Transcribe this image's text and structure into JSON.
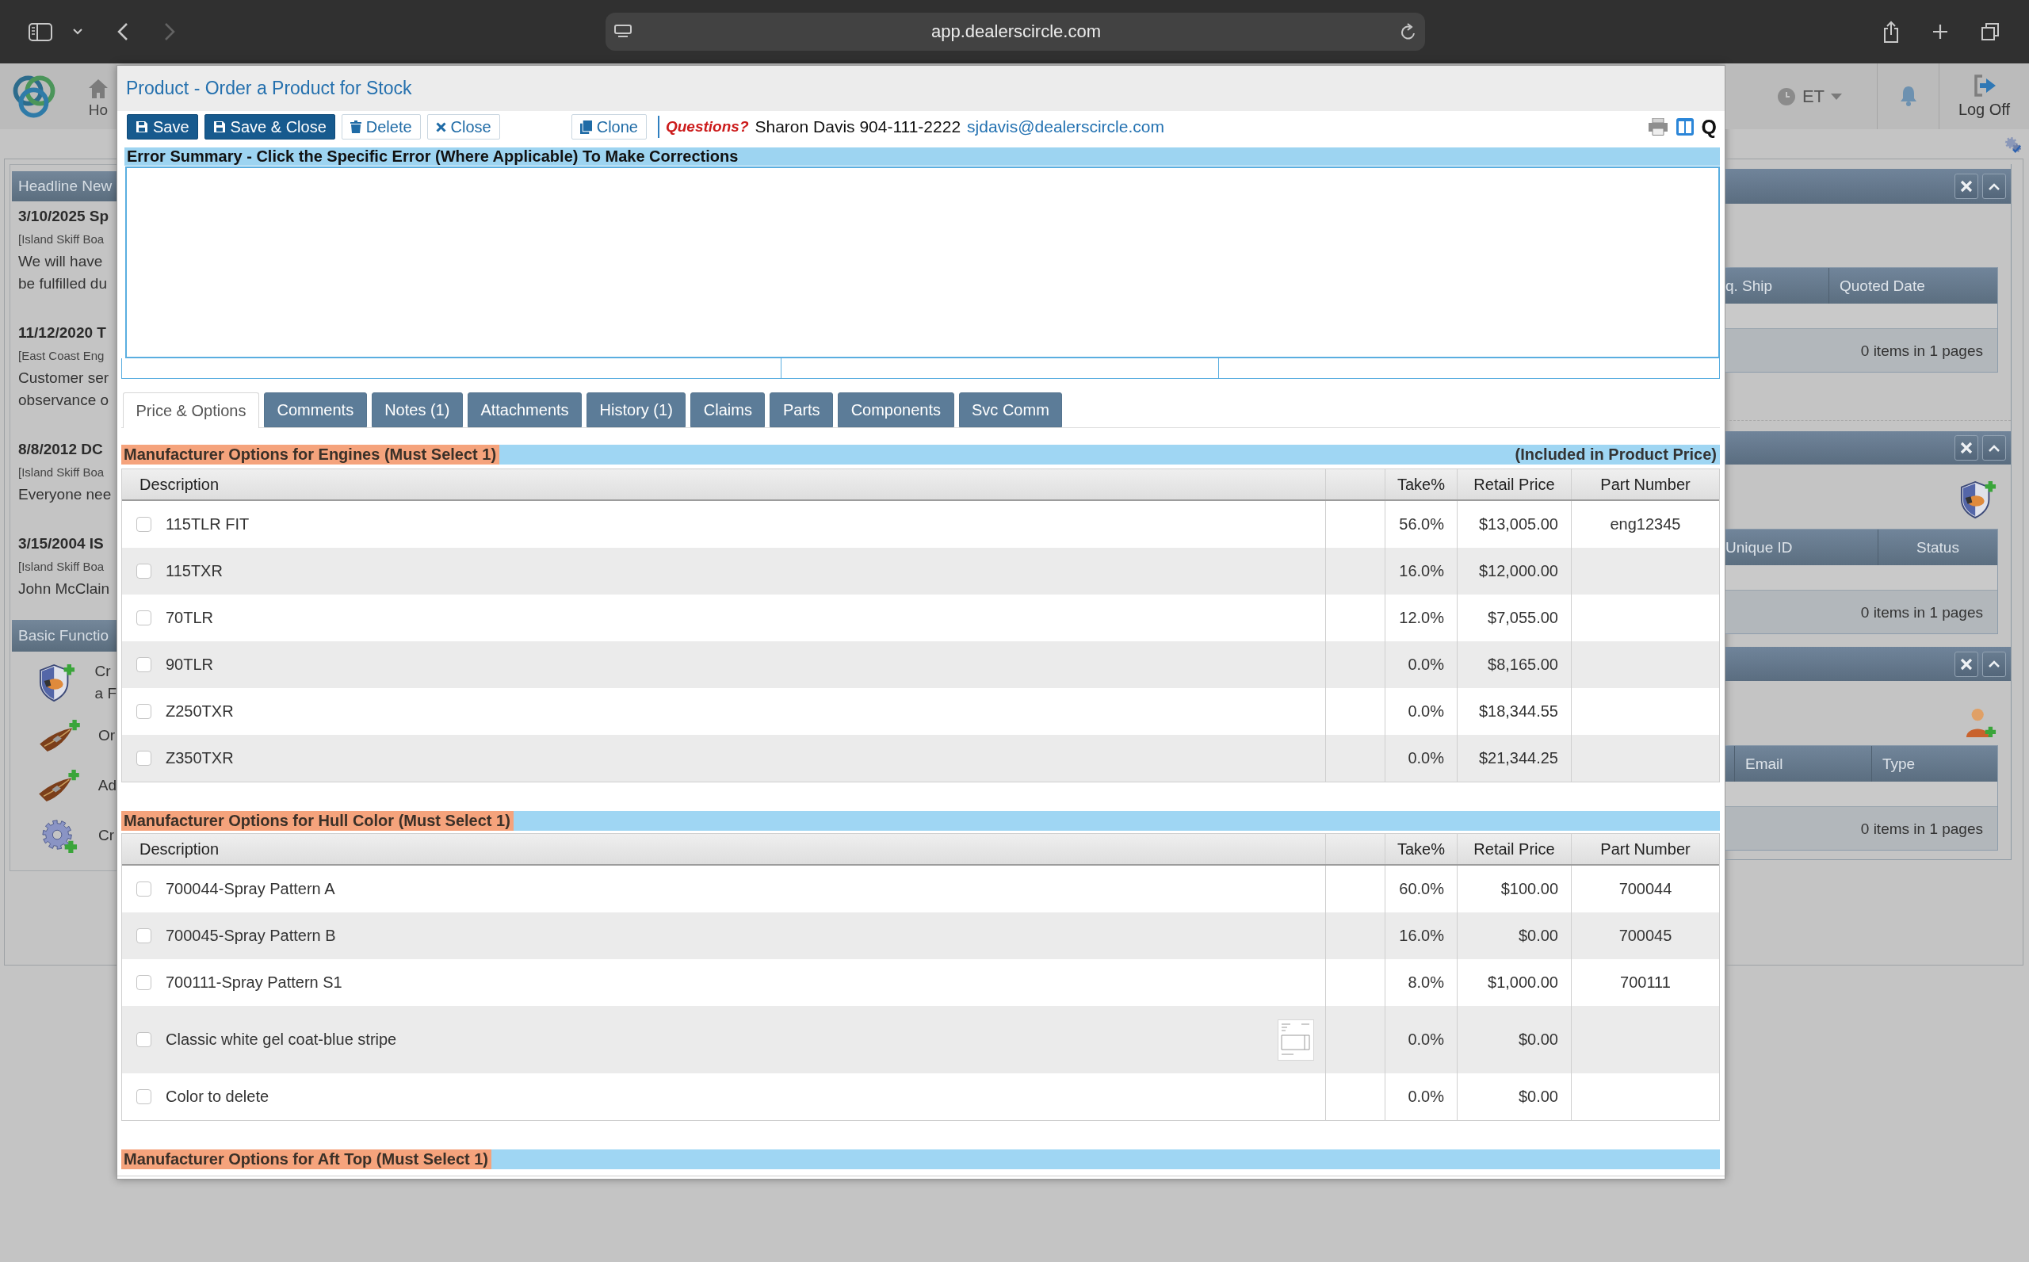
{
  "browser": {
    "url": "app.dealerscircle.com"
  },
  "app_header": {
    "home_label": "Ho",
    "timezone": "ET",
    "log_off": "Log Off"
  },
  "headline_news": {
    "title": "Headline New",
    "items": [
      {
        "title": "3/10/2025 Sp",
        "source": "[Island Skiff Boa",
        "lines": [
          "We will have",
          "be fulfilled du"
        ]
      },
      {
        "title": "11/12/2020 T",
        "source": "[East Coast Eng",
        "lines": [
          "Customer ser",
          "observance o"
        ]
      },
      {
        "title": "8/8/2012 DC",
        "source": "[Island Skiff Boa",
        "lines": [
          "Everyone nee"
        ]
      },
      {
        "title": "3/15/2004 IS",
        "source": "[Island Skiff Boa",
        "lines": [
          "John McClain"
        ]
      }
    ]
  },
  "basic_functions": {
    "title": "Basic Functio",
    "items": [
      {
        "lines": [
          "Cr",
          "a F"
        ]
      },
      {
        "lines": [
          "Or"
        ]
      },
      {
        "lines": [
          "Ad"
        ]
      },
      {
        "lines": [
          "Cr"
        ]
      }
    ]
  },
  "side_panels": [
    {
      "columns": [
        "q. Ship",
        "Quoted Date"
      ],
      "footer": "0 items in 1 pages"
    },
    {
      "columns": [
        "Unique ID",
        "Status"
      ],
      "footer": "0 items in 1 pages"
    },
    {
      "columns": [
        "Email",
        "Type"
      ],
      "footer": "0 items in 1 pages"
    }
  ],
  "modal": {
    "title": "Product - Order a Product for Stock",
    "buttons": [
      {
        "label": "Save",
        "kind": "primary"
      },
      {
        "label": "Save & Close",
        "kind": "primary"
      },
      {
        "label": "Delete",
        "kind": "plain"
      },
      {
        "label": "Close",
        "kind": "plain"
      }
    ],
    "clone_button": {
      "label": "Clone"
    },
    "contact": {
      "prompt": "Questions?",
      "person": "Sharon Davis 904-111-2222",
      "email": "sjdavis@dealerscircle.com"
    },
    "q_button": "Q",
    "error_summary": {
      "title": "Error Summary - Click the Specific Error (Where Applicable) To Make Corrections"
    },
    "tabs": [
      {
        "label": "Price & Options",
        "selected": true
      },
      {
        "label": "Comments",
        "selected": false
      },
      {
        "label": "Notes (1)",
        "selected": false
      },
      {
        "label": "Attachments",
        "selected": false
      },
      {
        "label": "History (1)",
        "selected": false
      },
      {
        "label": "Claims",
        "selected": false
      },
      {
        "label": "Parts",
        "selected": false
      },
      {
        "label": "Components",
        "selected": false
      },
      {
        "label": "Svc Comm",
        "selected": false
      }
    ],
    "sections": [
      {
        "title": "Manufacturer Options for Engines (Must Select 1)",
        "note": "(Included in Product Price)",
        "columns": [
          "Description",
          "Take%",
          "Retail Price",
          "Part Number"
        ],
        "rows": [
          {
            "description": "115TLR FIT",
            "checked": false,
            "take_percent": "56.0%",
            "retail_price": "$13,005.00",
            "part_number": "eng12345"
          },
          {
            "description": "115TXR",
            "checked": false,
            "take_percent": "16.0%",
            "retail_price": "$12,000.00"
          },
          {
            "description": "70TLR",
            "checked": false,
            "take_percent": "12.0%",
            "retail_price": "$7,055.00"
          },
          {
            "description": "90TLR",
            "checked": false,
            "take_percent": "0.0%",
            "retail_price": "$8,165.00"
          },
          {
            "description": "Z250TXR",
            "checked": false,
            "take_percent": "0.0%",
            "retail_price": "$18,344.55"
          },
          {
            "description": "Z350TXR",
            "checked": false,
            "take_percent": "0.0%",
            "retail_price": "$21,344.25"
          }
        ]
      },
      {
        "title": "Manufacturer Options for Hull Color (Must Select 1)",
        "columns": [
          "Description",
          "Take%",
          "Retail Price",
          "Part Number"
        ],
        "rows": [
          {
            "description": "700044-Spray Pattern A",
            "checked": false,
            "thumbnail": false,
            "take_percent": "60.0%",
            "retail_price": "$100.00",
            "part_number": "700044"
          },
          {
            "description": "700045-Spray Pattern B",
            "checked": false,
            "thumbnail": false,
            "take_percent": "16.0%",
            "retail_price": "$0.00",
            "part_number": "700045"
          },
          {
            "description": "700111-Spray Pattern S1",
            "checked": false,
            "thumbnail": false,
            "take_percent": "8.0%",
            "retail_price": "$1,000.00",
            "part_number": "700111"
          },
          {
            "description": "Classic white gel coat-blue stripe",
            "checked": false,
            "thumbnail": true,
            "take_percent": "0.0%",
            "retail_price": "$0.00"
          },
          {
            "description": "Color to delete",
            "checked": false,
            "thumbnail": false,
            "take_percent": "0.0%",
            "retail_price": "$0.00"
          }
        ]
      },
      {
        "title": "Manufacturer Options for Aft Top (Must Select 1)"
      }
    ]
  }
}
